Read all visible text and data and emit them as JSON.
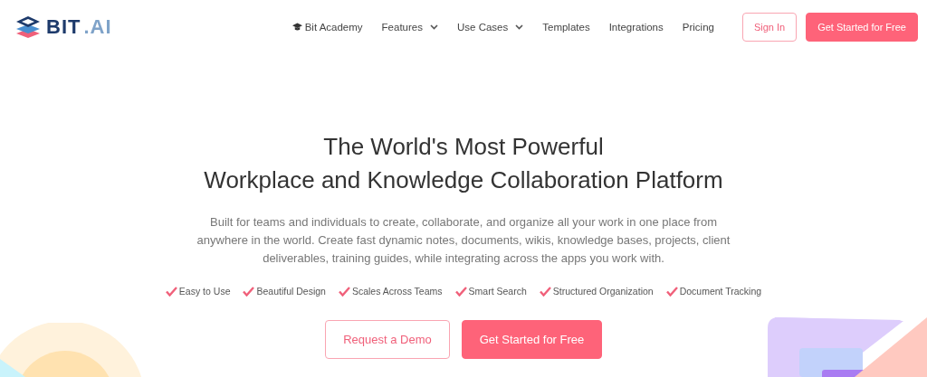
{
  "logo": {
    "word": "BIT",
    "suffix": ".AI"
  },
  "nav": [
    {
      "label": "Bit Academy",
      "kind": "academy"
    },
    {
      "label": "Features",
      "kind": "dropdown"
    },
    {
      "label": "Use Cases",
      "kind": "dropdown"
    },
    {
      "label": "Templates",
      "kind": "link"
    },
    {
      "label": "Integrations",
      "kind": "link"
    },
    {
      "label": "Pricing",
      "kind": "link"
    }
  ],
  "header_buttons": [
    {
      "label": "Sign In",
      "kind": "outline"
    },
    {
      "label": "Get Started for Free",
      "kind": "primary"
    }
  ],
  "hero": {
    "title_lines": [
      "The World's Most Powerful",
      "Workplace and Knowledge Collaboration Platform"
    ],
    "description": "Built for teams and individuals to create, collaborate, and organize all your work in one place from anywhere in the world. Create fast dynamic notes, documents, wikis, knowledge bases, projects, client deliverables, training guides, while integrating across the apps you work with.",
    "features": [
      "Easy to Use",
      "Beautiful Design",
      "Scales Across Teams",
      "Smart Search",
      "Structured Organization",
      "Document Tracking"
    ],
    "buttons": [
      {
        "label": "Request a Demo",
        "kind": "outline"
      },
      {
        "label": "Get Started for Free",
        "kind": "primary"
      }
    ]
  }
}
